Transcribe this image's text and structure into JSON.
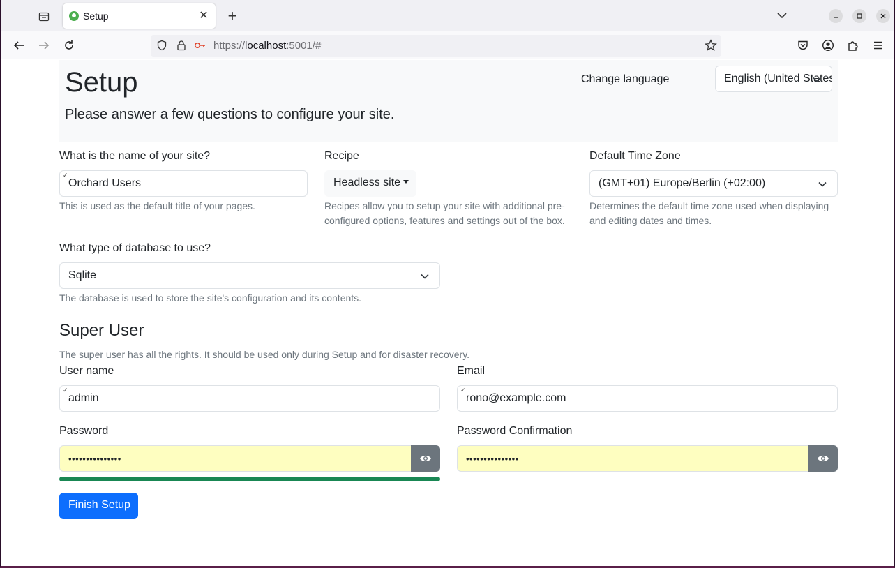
{
  "browser": {
    "tab_title": "Setup",
    "url_scheme": "https://",
    "url_host": "localhost",
    "url_rest": ":5001/#"
  },
  "hero": {
    "title": "Setup",
    "lead": "Please answer a few questions to configure your site.",
    "language_label": "Change language",
    "language_value": "English (United States)"
  },
  "site": {
    "name_label": "What is the name of your site?",
    "name_value": "Orchard Users",
    "name_help": "This is used as the default title of your pages.",
    "recipe_label": "Recipe",
    "recipe_value": "Headless site",
    "recipe_help_1": "Recipes allow you to setup your site with additional pre-",
    "recipe_help_2": "configured options, features and settings out of the box.",
    "tz_label": "Default Time Zone",
    "tz_value": "(GMT+01) Europe/Berlin (+02:00)",
    "tz_help_1": "Determines the default time zone used when displaying",
    "tz_help_2": "and editing dates and times."
  },
  "database": {
    "label": "What type of database to use?",
    "value": "Sqlite",
    "help": "The database is used to store the site's configuration and its contents."
  },
  "super_user": {
    "title": "Super User",
    "help": "The super user has all the rights. It should be used only during Setup and for disaster recovery.",
    "username_label": "User name",
    "username_value": "admin",
    "email_label": "Email",
    "email_value": "rono@example.com",
    "password_label": "Password",
    "password_value": "•••••••••••••••",
    "password_confirm_label": "Password Confirmation",
    "password_confirm_value": "•••••••••••••••",
    "password_strength": 1.0
  },
  "actions": {
    "finish_label": "Finish Setup"
  },
  "colors": {
    "primary": "#0d6efd",
    "success": "#198754",
    "autofill": "#fefec0",
    "secondary": "#6c757d"
  }
}
